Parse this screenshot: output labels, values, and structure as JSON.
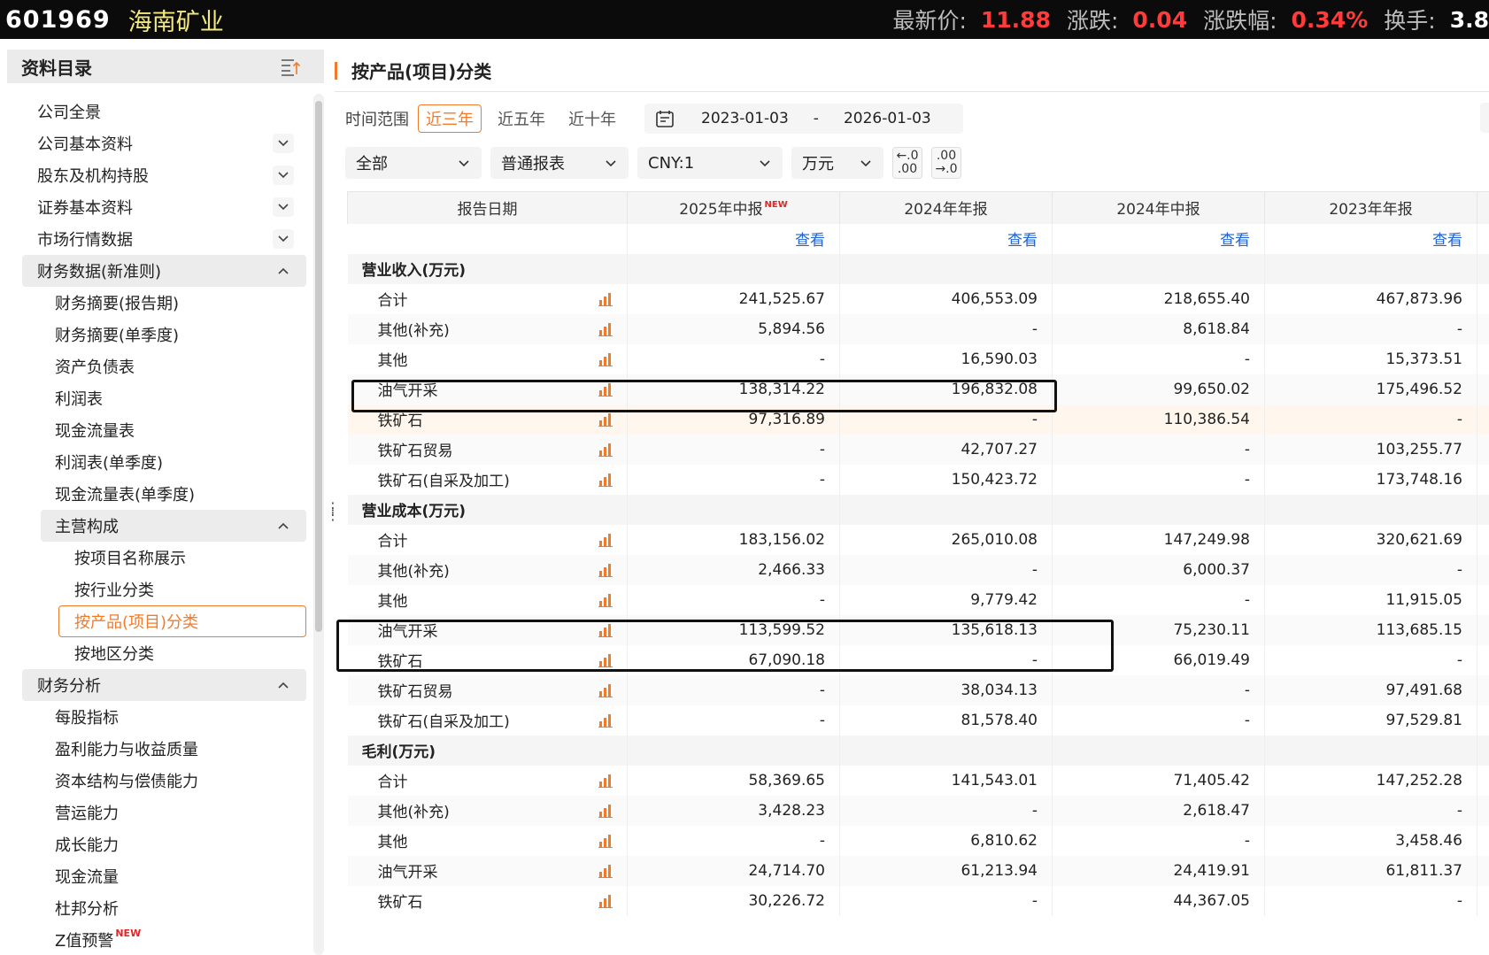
{
  "header": {
    "code": "601969",
    "name": "海南矿业",
    "quotes": [
      {
        "label": "最新价:",
        "value": "11.88"
      },
      {
        "label": "涨跌:",
        "value": "0.04"
      },
      {
        "label": "涨跌幅:",
        "value": "0.34%"
      },
      {
        "label": "换手:",
        "value": "3.8"
      }
    ]
  },
  "sidebar": {
    "title": "资料目录",
    "items": [
      {
        "label": "公司全景"
      },
      {
        "label": "公司基本资料"
      },
      {
        "label": "股东及机构持股"
      },
      {
        "label": "证券基本资料"
      },
      {
        "label": "市场行情数据"
      },
      {
        "label": "财务数据(新准则)"
      },
      {
        "label": "财务摘要(报告期)"
      },
      {
        "label": "财务摘要(单季度)"
      },
      {
        "label": "资产负债表"
      },
      {
        "label": "利润表"
      },
      {
        "label": "现金流量表"
      },
      {
        "label": "利润表(单季度)"
      },
      {
        "label": "现金流量表(单季度)"
      },
      {
        "label": "主营构成"
      },
      {
        "label": "按项目名称展示"
      },
      {
        "label": "按行业分类"
      },
      {
        "label": "按产品(项目)分类"
      },
      {
        "label": "按地区分类"
      },
      {
        "label": "财务分析"
      },
      {
        "label": "每股指标"
      },
      {
        "label": "盈利能力与收益质量"
      },
      {
        "label": "资本结构与偿债能力"
      },
      {
        "label": "营运能力"
      },
      {
        "label": "成长能力"
      },
      {
        "label": "现金流量"
      },
      {
        "label": "杜邦分析"
      },
      {
        "label": "Z值预警",
        "badge": "NEW"
      }
    ]
  },
  "main": {
    "title": "按产品(项目)分类",
    "time_range_label": "时间范围",
    "ranges": [
      "近三年",
      "近五年",
      "近十年"
    ],
    "date_start": "2023-01-03",
    "date_sep": "-",
    "date_end": "2026-01-03",
    "selects": [
      "全部",
      "普通报表",
      "CNY:1",
      "万元"
    ],
    "decimal_buttons": [
      {
        "top": "←.0",
        "bottom": ".00"
      },
      {
        "top": ".00",
        "bottom": "→.0"
      }
    ]
  },
  "table": {
    "header_label": "报告日期",
    "columns": [
      {
        "label": "2025年中报",
        "badge": "NEW"
      },
      {
        "label": "2024年年报"
      },
      {
        "label": "2024年中报"
      },
      {
        "label": "2023年年报"
      }
    ],
    "view_label": "查看",
    "sections": [
      {
        "title": "营业收入(万元)",
        "rows": [
          {
            "label": "合计",
            "values": [
              "241,525.67",
              "406,553.09",
              "218,655.40",
              "467,873.96"
            ]
          },
          {
            "label": "其他(补充)",
            "values": [
              "5,894.56",
              "-",
              "8,618.84",
              "-"
            ]
          },
          {
            "label": "其他",
            "values": [
              "-",
              "16,590.03",
              "-",
              "15,373.51"
            ]
          },
          {
            "label": "油气开采",
            "values": [
              "138,314.22",
              "196,832.08",
              "99,650.02",
              "175,496.52"
            ]
          },
          {
            "label": "铁矿石",
            "values": [
              "97,316.89",
              "-",
              "110,386.54",
              "-"
            ]
          },
          {
            "label": "铁矿石贸易",
            "values": [
              "-",
              "42,707.27",
              "-",
              "103,255.77"
            ]
          },
          {
            "label": "铁矿石(自采及加工)",
            "values": [
              "-",
              "150,423.72",
              "-",
              "173,748.16"
            ]
          }
        ]
      },
      {
        "title": "营业成本(万元)",
        "rows": [
          {
            "label": "合计",
            "values": [
              "183,156.02",
              "265,010.08",
              "147,249.98",
              "320,621.69"
            ]
          },
          {
            "label": "其他(补充)",
            "values": [
              "2,466.33",
              "-",
              "6,000.37",
              "-"
            ]
          },
          {
            "label": "其他",
            "values": [
              "-",
              "9,779.42",
              "-",
              "11,915.05"
            ]
          },
          {
            "label": "油气开采",
            "values": [
              "113,599.52",
              "135,618.13",
              "75,230.11",
              "113,685.15"
            ]
          },
          {
            "label": "铁矿石",
            "values": [
              "67,090.18",
              "-",
              "66,019.49",
              "-"
            ]
          },
          {
            "label": "铁矿石贸易",
            "values": [
              "-",
              "38,034.13",
              "-",
              "97,491.68"
            ]
          },
          {
            "label": "铁矿石(自采及加工)",
            "values": [
              "-",
              "81,578.40",
              "-",
              "97,529.81"
            ]
          }
        ]
      },
      {
        "title": "毛利(万元)",
        "rows": [
          {
            "label": "合计",
            "values": [
              "58,369.65",
              "141,543.01",
              "71,405.42",
              "147,252.28"
            ]
          },
          {
            "label": "其他(补充)",
            "values": [
              "3,428.23",
              "-",
              "2,618.47",
              "-"
            ]
          },
          {
            "label": "其他",
            "values": [
              "-",
              "6,810.62",
              "-",
              "3,458.46"
            ]
          },
          {
            "label": "油气开采",
            "values": [
              "24,714.70",
              "61,213.94",
              "24,419.91",
              "61,811.37"
            ]
          },
          {
            "label": "铁矿石",
            "values": [
              "30,226.72",
              "-",
              "44,367.05",
              "-"
            ]
          }
        ]
      }
    ]
  },
  "colors": {
    "accent": "#f07b2b",
    "price_up": "#ff3b3b",
    "link": "#1e64d2"
  }
}
